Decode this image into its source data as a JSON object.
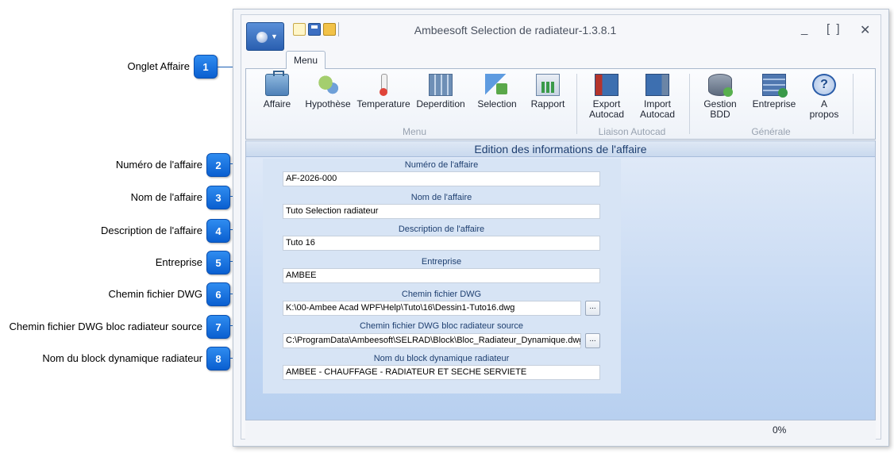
{
  "annotations": [
    {
      "number": "1",
      "label": "Onglet Affaire"
    },
    {
      "number": "2",
      "label": "Numéro de l'affaire"
    },
    {
      "number": "3",
      "label": "Nom de l'affaire"
    },
    {
      "number": "4",
      "label": "Description de l'affaire"
    },
    {
      "number": "5",
      "label": "Entreprise"
    },
    {
      "number": "6",
      "label": "Chemin fichier DWG"
    },
    {
      "number": "7",
      "label": "Chemin fichier DWG bloc radiateur source"
    },
    {
      "number": "8",
      "label": "Nom du block dynamique radiateur"
    }
  ],
  "window": {
    "title": "Ambeesoft Selection de radiateur-1.3.8.1",
    "minimize": "_",
    "maximize": "[ ]",
    "close": "✕"
  },
  "tab": {
    "label": "Menu"
  },
  "ribbon": {
    "buttons": [
      {
        "label": "Affaire",
        "icon": "briefcase-icon"
      },
      {
        "label": "Hypothèse",
        "icon": "gears-icon"
      },
      {
        "label": "Temperature",
        "icon": "thermometer-icon"
      },
      {
        "label": "Deperdition",
        "icon": "building-icon"
      },
      {
        "label": "Selection",
        "icon": "cursor-icon"
      },
      {
        "label": "Rapport",
        "icon": "report-icon"
      },
      {
        "label_1": "Export",
        "label_2": "Autocad",
        "icon": "autocad-export-icon"
      },
      {
        "label_1": "Import",
        "label_2": "Autocad",
        "icon": "autocad-import-icon"
      },
      {
        "label_1": "Gestion",
        "label_2": "BDD",
        "icon": "database-icon"
      },
      {
        "label": "Entreprise",
        "icon": "company-icon"
      },
      {
        "label_1": "A",
        "label_2": "propos",
        "icon": "help-icon"
      }
    ],
    "groups": [
      "Menu",
      "Liaison Autocad",
      "Générale"
    ]
  },
  "section_title": "Edition des informations de l'affaire",
  "form": {
    "numero": {
      "label": "Numéro de l'affaire",
      "value": "AF-2026-000"
    },
    "nom": {
      "label": "Nom de l'affaire",
      "value": "Tuto Selection radiateur"
    },
    "description": {
      "label": "Description de l'affaire",
      "value": "Tuto 16"
    },
    "entreprise": {
      "label": "Entreprise",
      "value": "AMBEE"
    },
    "chemin_dwg": {
      "label": "Chemin fichier DWG",
      "value": "K:\\00-Ambee Acad WPF\\Help\\Tuto\\16\\Dessin1-Tuto16.dwg"
    },
    "chemin_bloc": {
      "label": "Chemin fichier DWG bloc radiateur source",
      "value": "C:\\ProgramData\\Ambeesoft\\SELRAD\\Block\\Bloc_Radiateur_Dynamique.dwg"
    },
    "nom_block": {
      "label": "Nom du block dynamique radiateur",
      "value": "AMBEE - CHAUFFAGE -  RADIATEUR ET SECHE SERVIETE"
    },
    "browse_label": "..."
  },
  "status": {
    "progress": "0%"
  }
}
